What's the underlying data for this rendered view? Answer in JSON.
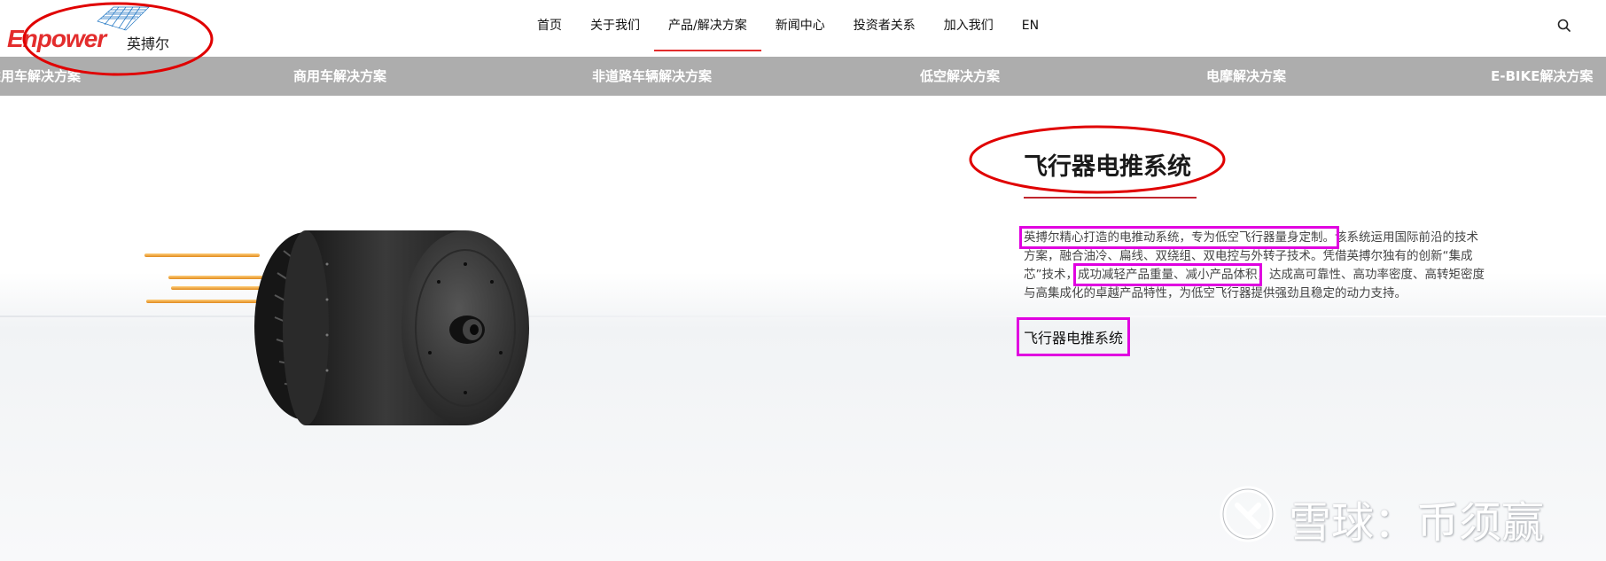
{
  "brand": {
    "name_en": "Enpower",
    "name_cn": "英搏尔"
  },
  "nav": {
    "items": [
      {
        "label": "首页"
      },
      {
        "label": "关于我们"
      },
      {
        "label": "产品/解决方案",
        "active": true
      },
      {
        "label": "新闻中心"
      },
      {
        "label": "投资者关系"
      },
      {
        "label": "加入我们"
      },
      {
        "label": "EN"
      }
    ],
    "search_icon": "search-icon"
  },
  "subnav": {
    "items": [
      {
        "label": "乘用车解决方案"
      },
      {
        "label": "商用车解决方案"
      },
      {
        "label": "非道路车辆解决方案"
      },
      {
        "label": "低空解决方案"
      },
      {
        "label": "电摩解决方案"
      },
      {
        "label": "E-BIKE解决方案"
      }
    ]
  },
  "product": {
    "title": "飞行器电推系统",
    "desc_part1": "英搏尔精心打造的电推动系统，专为低空飞行器量身定制。",
    "desc_part2": "该系统运用国际前沿的技术方案，融合油冷、扁线、双绕组、双电控与外转子技术。凭借英搏尔独有的创新“集成芯”技术，",
    "desc_part3": "成功减轻产品重量、减小产品体积",
    "desc_part4": "，达成高可靠性、高功率密度、高转矩密度与高集成化的卓越产品特性，为低空飞行器提供强劲且稳定的动力支持。",
    "link_label": "飞行器电推系统"
  },
  "watermark": {
    "text": "雪球：币须赢"
  },
  "colors": {
    "brand_red": "#e32d2d",
    "subnav_bg": "#adadad",
    "annotation_red": "#e00000",
    "annotation_magenta": "#e000e0"
  }
}
